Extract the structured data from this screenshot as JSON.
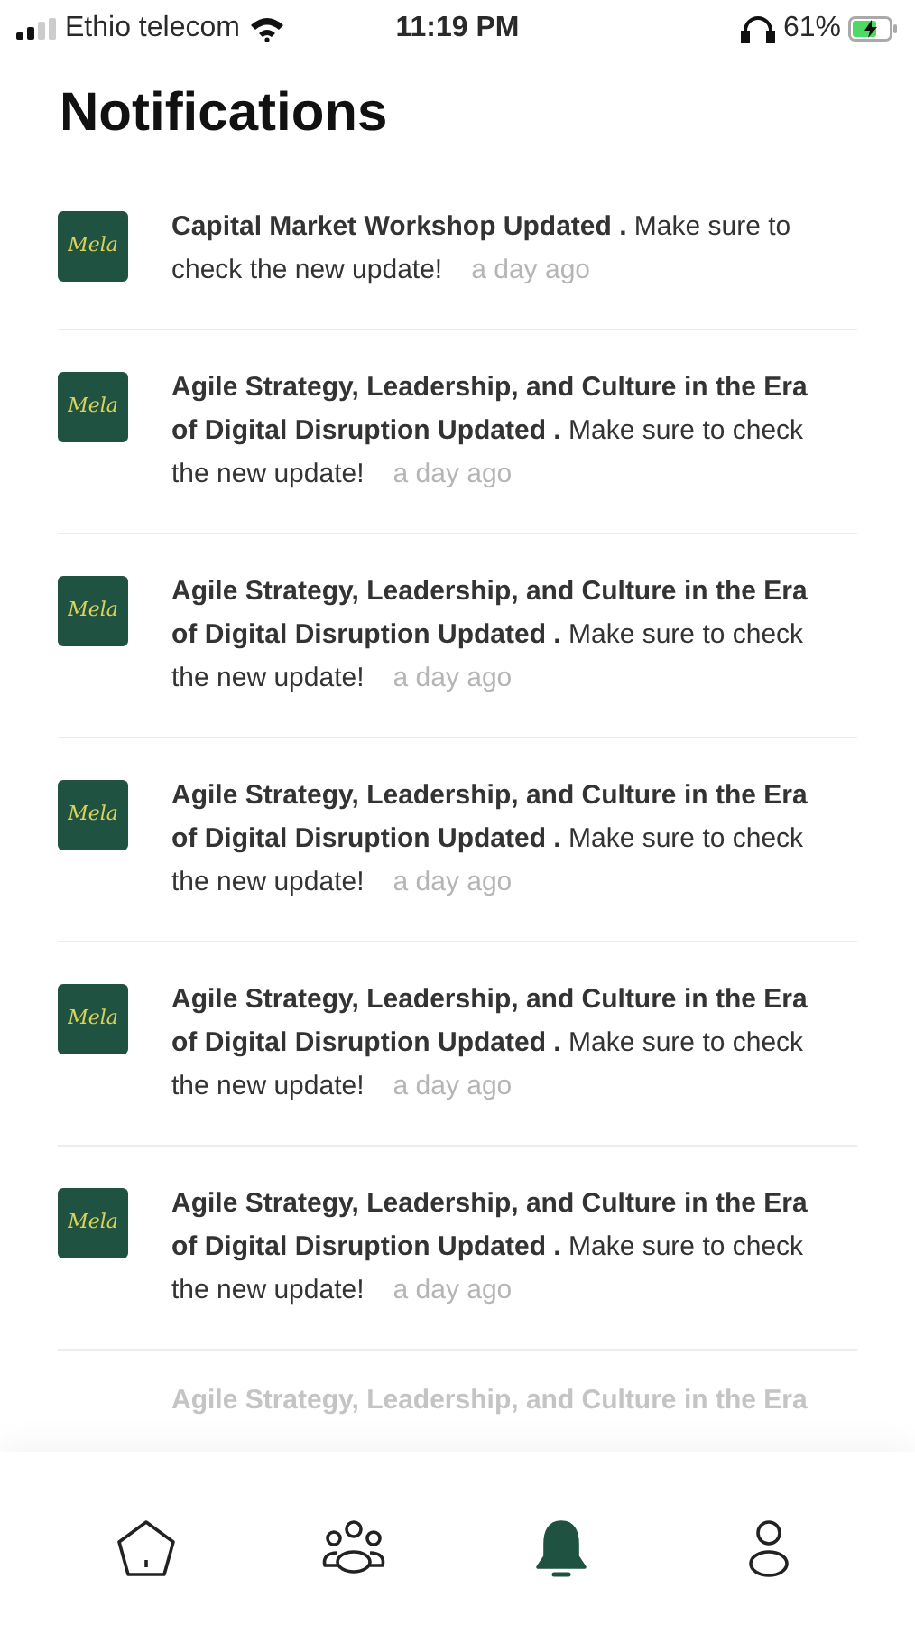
{
  "status_bar": {
    "carrier": "Ethio telecom",
    "time": "11:19 PM",
    "battery": "61%"
  },
  "title": "Notifications",
  "notifications": [
    {
      "logo": "Mela",
      "text": "**Capital Market Workshop   Updated .** Make sure to check the new update!",
      "time": "a day ago"
    },
    {
      "logo": "Mela",
      "text": "**Agile Strategy, Leadership, and Culture in the Era of Digital Disruption Updated .** Make sure to check the new update!",
      "time": "a day ago"
    },
    {
      "logo": "Mela",
      "text": "**Agile Strategy, Leadership, and Culture in the Era of Digital Disruption Updated .** Make sure to check the new update!",
      "time": "a day ago"
    },
    {
      "logo": "Mela",
      "text": "**Agile Strategy, Leadership, and Culture in the Era of Digital Disruption Updated .** Make sure to check the new update!",
      "time": "a day ago"
    },
    {
      "logo": "Mela",
      "text": "**Agile Strategy, Leadership, and Culture in the Era of Digital Disruption Updated .** Make sure to check the new update!",
      "time": "a day ago"
    },
    {
      "logo": "Mela",
      "text": "**Agile Strategy, Leadership, and Culture in the Era of Digital Disruption Updated .** Make sure to check the new update!",
      "time": "a day ago"
    }
  ],
  "cut_off_item": {
    "text": "Agile Strategy, Leadership, and Culture in the Era"
  },
  "nav": [
    {
      "kind": "home",
      "selected": false
    },
    {
      "kind": "community",
      "selected": false
    },
    {
      "kind": "notifications",
      "selected": true
    },
    {
      "kind": "profile",
      "selected": false
    }
  ]
}
